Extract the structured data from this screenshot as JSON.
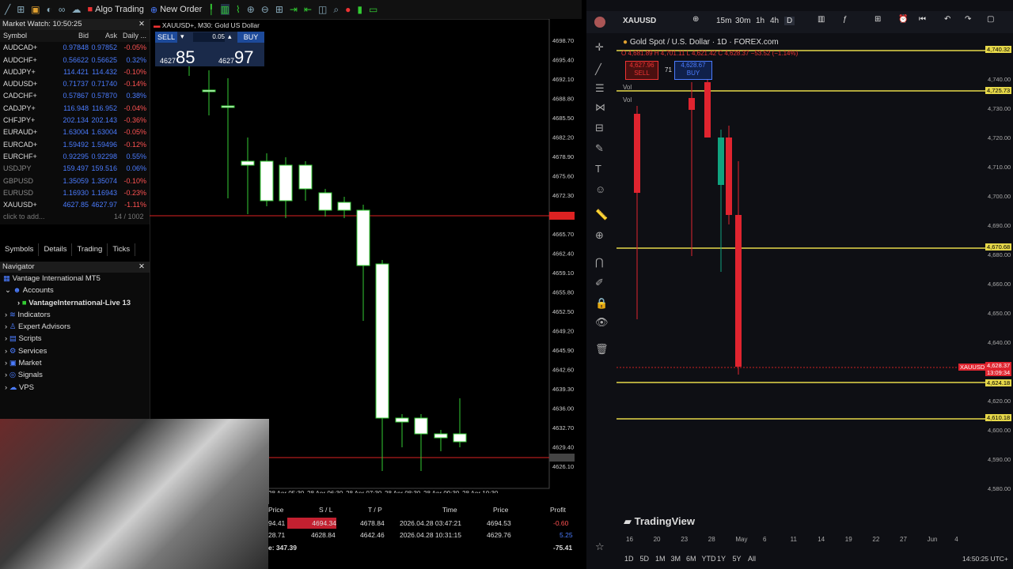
{
  "mt5": {
    "toolbar": {
      "algo_trading": "Algo Trading",
      "new_order": "New Order"
    },
    "market_watch": {
      "title": "Market Watch: 10:50:25",
      "col_symbol": "Symbol",
      "col_bid": "Bid",
      "col_ask": "Ask",
      "col_daily": "Daily ...",
      "rows": [
        {
          "symbol": "AUDCAD+",
          "bid": "0.97848",
          "ask": "0.97852",
          "chg": "-0.05%"
        },
        {
          "symbol": "AUDCHF+",
          "bid": "0.56622",
          "ask": "0.56625",
          "chg": "0.32%"
        },
        {
          "symbol": "AUDJPY+",
          "bid": "114.421",
          "ask": "114.432",
          "chg": "-0.10%"
        },
        {
          "symbol": "AUDUSD+",
          "bid": "0.71737",
          "ask": "0.71740",
          "chg": "-0.14%"
        },
        {
          "symbol": "CADCHF+",
          "bid": "0.57867",
          "ask": "0.57870",
          "chg": "0.38%"
        },
        {
          "symbol": "CADJPY+",
          "bid": "116.948",
          "ask": "116.952",
          "chg": "-0.04%"
        },
        {
          "symbol": "CHFJPY+",
          "bid": "202.134",
          "ask": "202.143",
          "chg": "-0.36%"
        },
        {
          "symbol": "EURAUD+",
          "bid": "1.63004",
          "ask": "1.63004",
          "chg": "-0.05%"
        },
        {
          "symbol": "EURCAD+",
          "bid": "1.59492",
          "ask": "1.59496",
          "chg": "-0.12%"
        },
        {
          "symbol": "EURCHF+",
          "bid": "0.92295",
          "ask": "0.92298",
          "chg": "0.55%"
        },
        {
          "symbol": "USDJPY",
          "bid": "159.497",
          "ask": "159.516",
          "chg": "0.06%"
        },
        {
          "symbol": "GBPUSD",
          "bid": "1.35059",
          "ask": "1.35074",
          "chg": "-0.10%"
        },
        {
          "symbol": "EURUSD",
          "bid": "1.16930",
          "ask": "1.16943",
          "chg": "-0.23%"
        },
        {
          "symbol": "XAUUSD+",
          "bid": "4627.85",
          "ask": "4627.97",
          "chg": "-1.11%"
        }
      ],
      "add_symbol": "click to add...",
      "count": "14 / 1002"
    },
    "tabs": [
      "Symbols",
      "Details",
      "Trading",
      "Ticks"
    ],
    "navigator": {
      "title": "Navigator",
      "items": [
        "Vantage International MT5",
        "Accounts",
        "VantageInternational-Live 13",
        "Indicators",
        "Expert Advisors",
        "Scripts",
        "Services",
        "Market",
        "Signals",
        "VPS"
      ]
    },
    "chart": {
      "title": "XAUUSD+, M30: Gold US Dollar",
      "sell_label": "SELL",
      "buy_label": "BUY",
      "lot": "0.05",
      "sell_small": "4627",
      "sell_big": "85",
      "buy_small": "4627",
      "buy_big": "97",
      "price_axis": [
        "4698.70",
        "4695.40",
        "4692.10",
        "4688.80",
        "4685.50",
        "4682.20",
        "4678.90",
        "4675.60",
        "4672.30",
        "4669.00",
        "4665.70",
        "4662.40",
        "4659.10",
        "4655.80",
        "4652.50",
        "4649.20",
        "4645.90",
        "4642.60",
        "4639.30",
        "4636.00",
        "4632.70",
        "4629.40",
        "4626.10"
      ],
      "time_axis": [
        "28 Apr 05:30",
        "28 Apr 06:30",
        "28 Apr 07:30",
        "28 Apr 08:30",
        "28 Apr 09:30",
        "28 Apr 10:30"
      ]
    },
    "trades": {
      "headers": [
        "Price",
        "S / L",
        "T / P",
        "Time",
        "Price",
        "Profit"
      ],
      "rows": [
        [
          "94.41",
          "4694.34",
          "4678.84",
          "2026.04.28 03:47:21",
          "4694.53",
          "-0.60"
        ],
        [
          "28.71",
          "4628.84",
          "4642.46",
          "2026.04.28 10:31:15",
          "4629.76",
          "5.25"
        ]
      ],
      "balance": "e: 347.39",
      "total": "-75.41"
    }
  },
  "tv": {
    "symbol": "XAUUSD",
    "timeframes": [
      "15m",
      "30m",
      "1h",
      "4h",
      "D"
    ],
    "legend": "Gold Spot / U.S. Dollar · 1D · FOREX.com",
    "ohlc": "O 4,681.89  H 4,701.11  L 4,621.42  C 4,628.37  −53.52 (−1.14%)",
    "sell_price": "4,627.96",
    "sell_label": "SELL",
    "buy_price": "4,628.67",
    "buy_label": "BUY",
    "spread": "71",
    "vol_label": "Vol",
    "price_axis": [
      "4,740.00",
      "4,730.00",
      "4,720.00",
      "4,710.00",
      "4,700.00",
      "4,690.00",
      "4,680.00",
      "4,660.00",
      "4,650.00",
      "4,640.00",
      "4,630.00",
      "4,620.00",
      "4,600.00",
      "4,590.00",
      "4,580.00"
    ],
    "level_labels": [
      "4,740.32",
      "4,725.73",
      "4,670.68",
      "4,624.18",
      "4,610.18"
    ],
    "current_label": "XAUUSD",
    "current_price": "4,628.37",
    "countdown": "13:09:34",
    "brand": "TradingView",
    "date_axis": [
      "16",
      "20",
      "23",
      "28",
      "May",
      "6",
      "11",
      "14",
      "19",
      "22",
      "27",
      "Jun",
      "4"
    ],
    "periods": [
      "1D",
      "5D",
      "1M",
      "3M",
      "6M",
      "YTD",
      "1Y",
      "5Y",
      "All"
    ],
    "clock": "14:50:25 UTC+"
  }
}
